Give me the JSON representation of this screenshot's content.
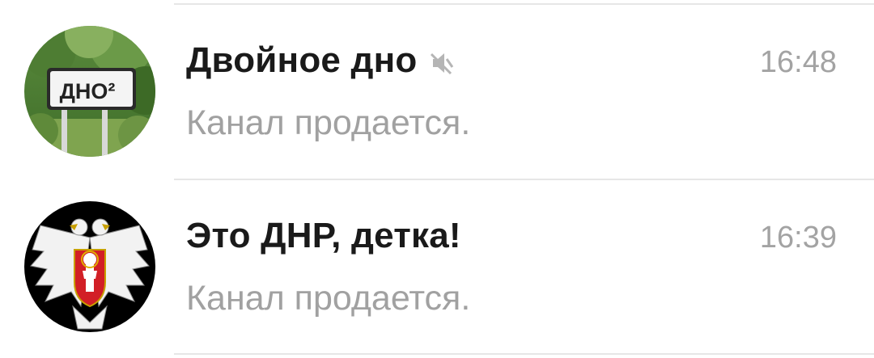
{
  "chats": [
    {
      "title": "Двойное дно",
      "time": "16:48",
      "preview": "Канал продается.",
      "muted": true,
      "avatar": {
        "icon": "road-sign-avatar",
        "sign_text": "ДНО²"
      }
    },
    {
      "title": "Это ДНР, детка!",
      "time": "16:39",
      "preview": "Канал продается.",
      "muted": false,
      "avatar": {
        "icon": "dpr-coat-of-arms-avatar"
      }
    }
  ],
  "colors": {
    "title": "#1a1a1a",
    "secondary": "#a1a1a1",
    "divider": "#e6e6e6"
  }
}
